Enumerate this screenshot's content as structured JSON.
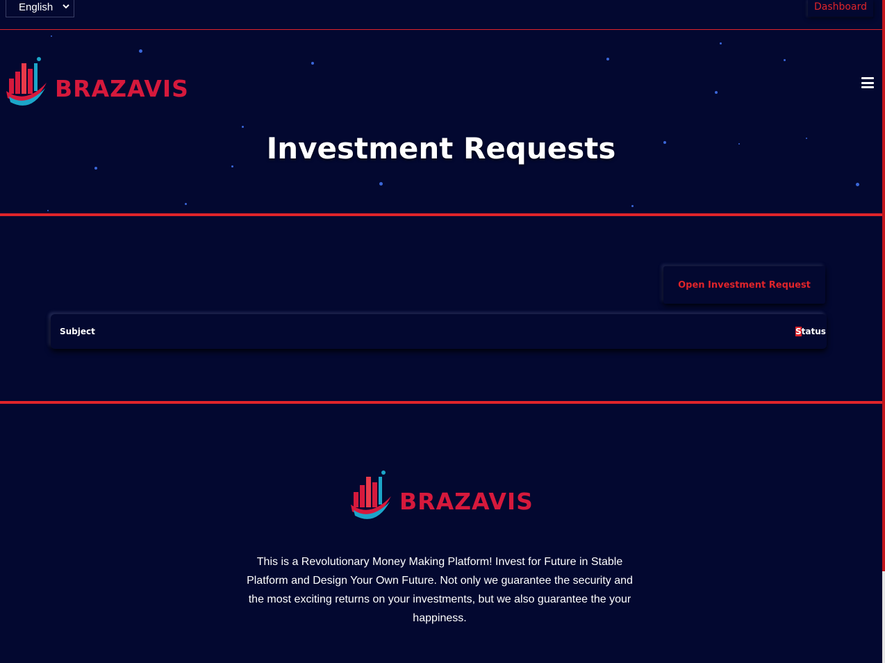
{
  "topbar": {
    "language_selected": "English",
    "dashboard_label": "Dashboard"
  },
  "brand": {
    "name": "BRAZAVIS",
    "color": "#d6193c"
  },
  "hero": {
    "title": "Investment Requests"
  },
  "actions": {
    "open_request_label": "Open Investment Request"
  },
  "table": {
    "columns": [
      "Subject",
      "Status"
    ]
  },
  "footer": {
    "brand_name": "BRAZAVIS",
    "description": "This is a Revolutionary Money Making Platform! Invest for Future in Stable Platform and Design Your Own Future. Not only we guarantee the security and the most exciting returns on your investments, but we also guarantee the your happiness."
  },
  "colors": {
    "background": "#030830",
    "accent": "#e0242a",
    "star": "#3a66d8"
  },
  "icons": [
    "chevron-down-icon",
    "hamburger-menu-icon",
    "brand-logo-icon"
  ]
}
